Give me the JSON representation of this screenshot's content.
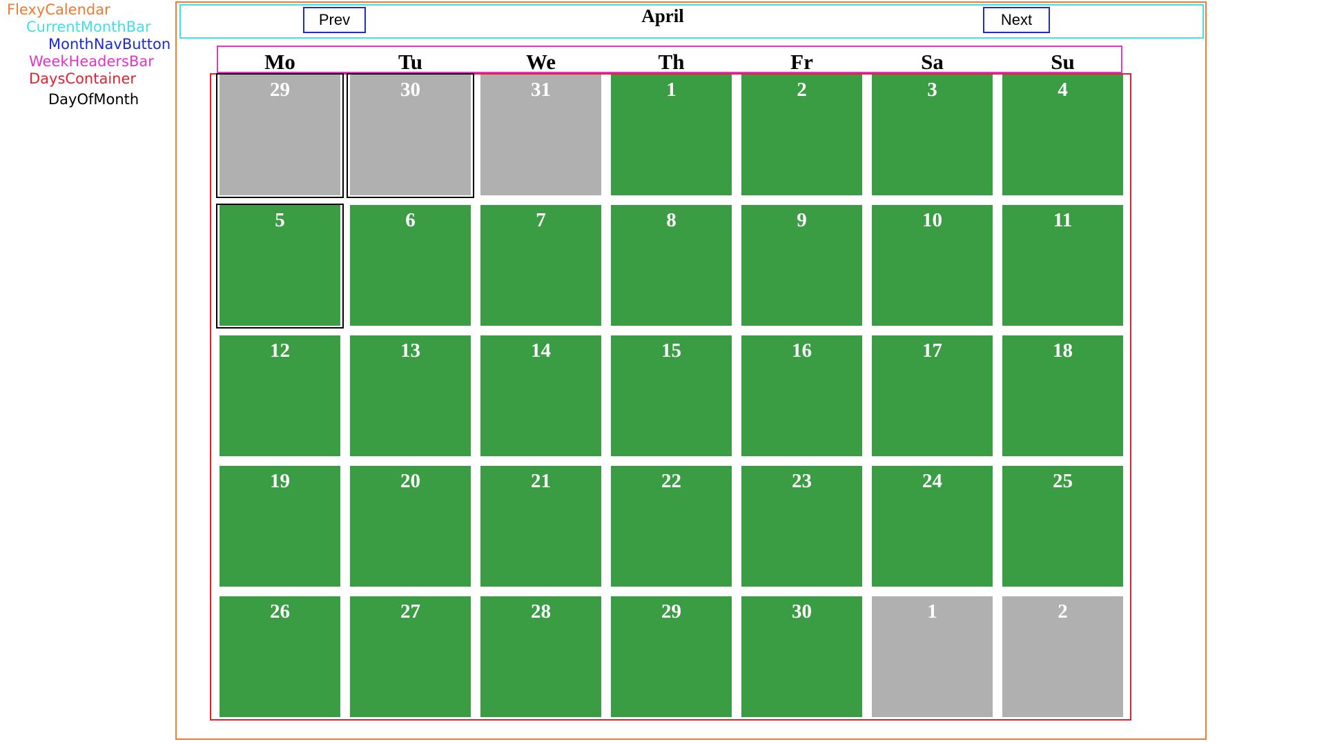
{
  "legend": {
    "flexy_calendar": "FlexyCalendar",
    "current_month_bar": "CurrentMonthBar",
    "month_nav_button": "MonthNavButton",
    "week_headers_bar": "WeekHeadersBar",
    "days_container": "DaysContainer",
    "day_of_month": "DayOfMonth"
  },
  "colors": {
    "flexy_calendar": "#f27a2e",
    "current_month_bar": "#3fe0e6",
    "month_nav_button": "#1a2bd0",
    "week_headers_bar": "#e433c8",
    "days_container": "#e5202d",
    "current_month_day": "#3a9c43",
    "other_month_day": "#b0b0b0"
  },
  "nav": {
    "prev": "Prev",
    "next": "Next"
  },
  "month": "April",
  "weekdays": [
    "Mo",
    "Tu",
    "We",
    "Th",
    "Fr",
    "Sa",
    "Su"
  ],
  "days": [
    {
      "label": "29",
      "type": "other"
    },
    {
      "label": "30",
      "type": "other"
    },
    {
      "label": "31",
      "type": "other"
    },
    {
      "label": "1",
      "type": "cur"
    },
    {
      "label": "2",
      "type": "cur"
    },
    {
      "label": "3",
      "type": "cur"
    },
    {
      "label": "4",
      "type": "cur"
    },
    {
      "label": "5",
      "type": "cur"
    },
    {
      "label": "6",
      "type": "cur"
    },
    {
      "label": "7",
      "type": "cur"
    },
    {
      "label": "8",
      "type": "cur"
    },
    {
      "label": "9",
      "type": "cur"
    },
    {
      "label": "10",
      "type": "cur"
    },
    {
      "label": "11",
      "type": "cur"
    },
    {
      "label": "12",
      "type": "cur"
    },
    {
      "label": "13",
      "type": "cur"
    },
    {
      "label": "14",
      "type": "cur"
    },
    {
      "label": "15",
      "type": "cur"
    },
    {
      "label": "16",
      "type": "cur"
    },
    {
      "label": "17",
      "type": "cur"
    },
    {
      "label": "18",
      "type": "cur"
    },
    {
      "label": "19",
      "type": "cur"
    },
    {
      "label": "20",
      "type": "cur"
    },
    {
      "label": "21",
      "type": "cur"
    },
    {
      "label": "22",
      "type": "cur"
    },
    {
      "label": "23",
      "type": "cur"
    },
    {
      "label": "24",
      "type": "cur"
    },
    {
      "label": "25",
      "type": "cur"
    },
    {
      "label": "26",
      "type": "cur"
    },
    {
      "label": "27",
      "type": "cur"
    },
    {
      "label": "28",
      "type": "cur"
    },
    {
      "label": "29",
      "type": "cur"
    },
    {
      "label": "30",
      "type": "cur"
    },
    {
      "label": "1",
      "type": "other"
    },
    {
      "label": "2",
      "type": "other"
    }
  ],
  "outlined_day_indices": [
    0,
    1,
    7
  ]
}
